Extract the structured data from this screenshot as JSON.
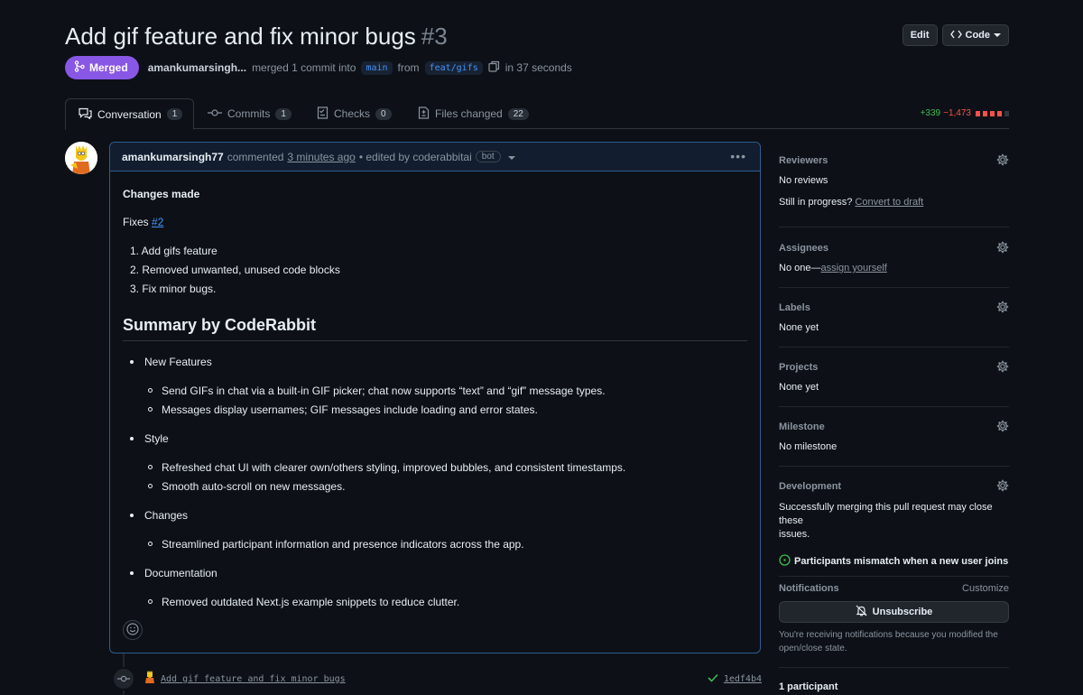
{
  "header": {
    "title": "Add gif feature and fix minor bugs",
    "number": "#3",
    "edit_label": "Edit",
    "code_label": "Code"
  },
  "meta": {
    "status": "Merged",
    "author": "amankumarsingh...",
    "action": "merged 1 commit into",
    "base_branch": "main",
    "from": "from",
    "head_branch": "feat/gifs",
    "duration": "in 37 seconds"
  },
  "tabs": [
    {
      "label": "Conversation",
      "count": "1",
      "icon": "comment-discussion-icon"
    },
    {
      "label": "Commits",
      "count": "1",
      "icon": "git-commit-icon"
    },
    {
      "label": "Checks",
      "count": "0",
      "icon": "checklist-icon"
    },
    {
      "label": "Files changed",
      "count": "22",
      "icon": "file-diff-icon"
    }
  ],
  "diffstat": {
    "additions": "+339",
    "deletions": "−1,473"
  },
  "comment": {
    "author": "amankumarsingh77",
    "commented": "commented",
    "time": "3 minutes ago",
    "edited": "• edited by coderabbitai",
    "bot": "bot",
    "changes_heading": "Changes made",
    "fixes_label": "Fixes",
    "fixes_link": "#2",
    "changes": [
      "1. Add gifs feature",
      "2. Removed unwanted, unused code blocks",
      "3. Fix minor bugs."
    ],
    "summary_heading": "Summary by CodeRabbit",
    "summary": [
      {
        "heading": "New Features",
        "items": [
          "Send GIFs in chat via a built-in GIF picker; chat now supports “text” and “gif” message types.",
          "Messages display usernames; GIF messages include loading and error states."
        ]
      },
      {
        "heading": "Style",
        "items": [
          "Refreshed chat UI with clearer own/others styling, improved bubbles, and consistent timestamps.",
          "Smooth auto-scroll on new messages."
        ]
      },
      {
        "heading": "Changes",
        "items": [
          "Streamlined participant information and presence indicators across the app."
        ]
      },
      {
        "heading": "Documentation",
        "items": [
          "Removed outdated Next.js example snippets to reduce clutter."
        ]
      }
    ]
  },
  "commit": {
    "message": "Add gif feature and fix minor bugs",
    "sha": "1edf4b4"
  },
  "sidebar": {
    "reviewers": {
      "heading": "Reviewers",
      "value": "No reviews",
      "progress_label": "Still in progress?",
      "progress_link": "Convert to draft"
    },
    "assignees": {
      "heading": "Assignees",
      "value": "No one—",
      "link": "assign yourself"
    },
    "labels": {
      "heading": "Labels",
      "value": "None yet"
    },
    "projects": {
      "heading": "Projects",
      "value": "None yet"
    },
    "milestone": {
      "heading": "Milestone",
      "value": "No milestone"
    },
    "development": {
      "heading": "Development",
      "line1": "Successfully merging this pull request may close these",
      "line2": "issues.",
      "issue": "Participants mismatch when a new user joins"
    },
    "notifications": {
      "heading": "Notifications",
      "customize": "Customize",
      "button": "Unsubscribe",
      "note1": "You're receiving notifications because you modified the",
      "note2": "open/close state."
    },
    "participants": {
      "heading": "1 participant"
    }
  },
  "colors": {
    "merged": "#8957e5",
    "link": "#4493f8",
    "add": "#3fb950",
    "del": "#f85149"
  }
}
